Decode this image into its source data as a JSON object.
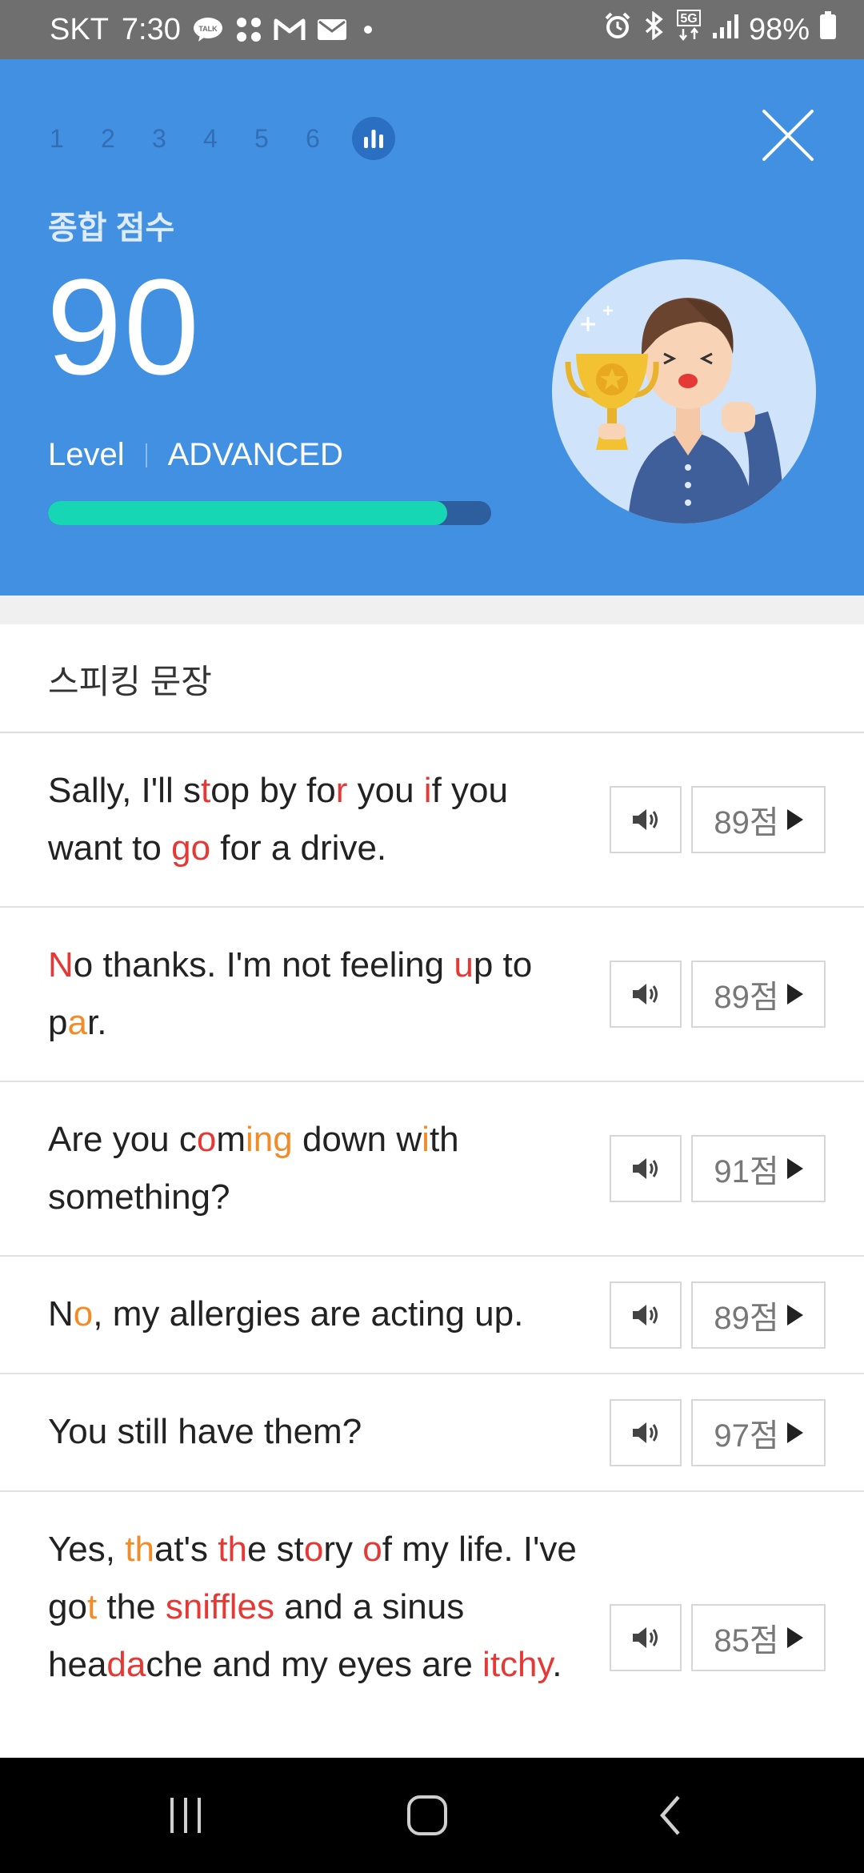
{
  "status_bar": {
    "carrier": "SKT",
    "time": "7:30",
    "battery": "98%",
    "left_icons": [
      "kakaotalk-icon",
      "apps-icon",
      "gmail-icon",
      "mail-icon",
      "dot-icon"
    ],
    "right_icons": [
      "alarm-icon",
      "bluetooth-icon",
      "5g-icon",
      "signal-icon",
      "battery-icon"
    ]
  },
  "header": {
    "steps": [
      "1",
      "2",
      "3",
      "4",
      "5",
      "6"
    ],
    "active_step_icon": "bar-chart-icon",
    "score_label": "종합 점수",
    "score": "90",
    "level_label": "Level",
    "level_value": "ADVANCED",
    "progress": 0.9,
    "colors": {
      "background": "#4290e2",
      "progress_fill": "#16d6b4",
      "progress_track": "#2d5f9f"
    }
  },
  "section_title": "스피킹 문장",
  "sentences": [
    {
      "segments": [
        {
          "t": "Sally, I'll s"
        },
        {
          "t": "t",
          "c": "r"
        },
        {
          "t": "op by fo"
        },
        {
          "t": "r",
          "c": "r"
        },
        {
          "t": " you "
        },
        {
          "t": "i",
          "c": "r"
        },
        {
          "t": "f you want to "
        },
        {
          "t": "go",
          "c": "r"
        },
        {
          "t": " for a drive."
        }
      ],
      "score": "89점"
    },
    {
      "segments": [
        {
          "t": "N",
          "c": "r"
        },
        {
          "t": "o thanks. I'm not feeling "
        },
        {
          "t": "u",
          "c": "r"
        },
        {
          "t": "p to p"
        },
        {
          "t": "a",
          "c": "o"
        },
        {
          "t": "r."
        }
      ],
      "score": "89점"
    },
    {
      "segments": [
        {
          "t": "Are you c"
        },
        {
          "t": "o",
          "c": "r"
        },
        {
          "t": "m"
        },
        {
          "t": "ing",
          "c": "o"
        },
        {
          "t": " down w"
        },
        {
          "t": "i",
          "c": "o"
        },
        {
          "t": "th something?"
        }
      ],
      "score": "91점"
    },
    {
      "segments": [
        {
          "t": "N"
        },
        {
          "t": "o",
          "c": "o"
        },
        {
          "t": ", my allergies are acting up."
        }
      ],
      "score": "89점"
    },
    {
      "segments": [
        {
          "t": "You still have them?"
        }
      ],
      "score": "97점"
    },
    {
      "segments": [
        {
          "t": "Yes, "
        },
        {
          "t": "th",
          "c": "o"
        },
        {
          "t": "at's "
        },
        {
          "t": "th",
          "c": "r"
        },
        {
          "t": "e st"
        },
        {
          "t": "o",
          "c": "r"
        },
        {
          "t": "ry "
        },
        {
          "t": "o",
          "c": "r"
        },
        {
          "t": "f my life. I've go"
        },
        {
          "t": "t",
          "c": "o"
        },
        {
          "t": " the "
        },
        {
          "t": "sniffles",
          "c": "r"
        },
        {
          "t": " and a sinus hea"
        },
        {
          "t": "da",
          "c": "r"
        },
        {
          "t": "che and my eyes are "
        },
        {
          "t": "itchy",
          "c": "r"
        },
        {
          "t": "."
        }
      ],
      "score": "85점"
    }
  ],
  "highlight_colors": {
    "r": "#e53935",
    "o": "#f28c28"
  },
  "nav_bar": {
    "icons": [
      "recent-apps-icon",
      "home-icon",
      "back-icon"
    ]
  }
}
